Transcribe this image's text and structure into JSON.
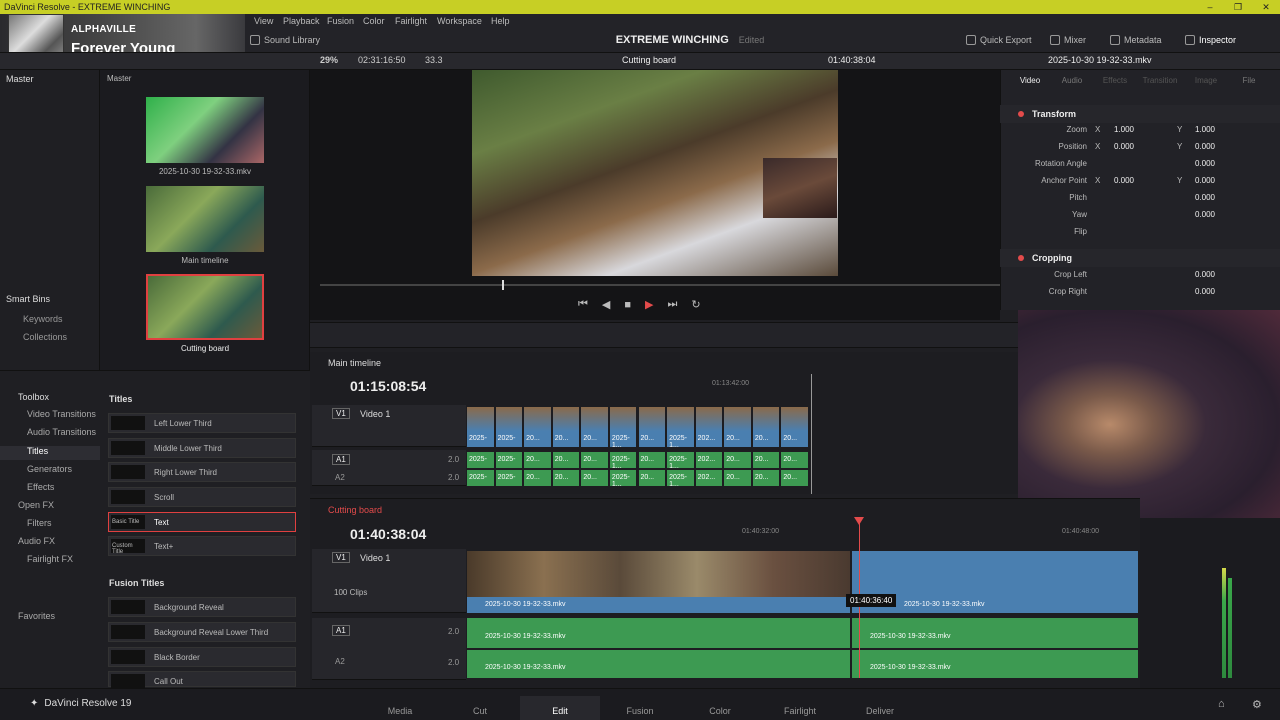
{
  "window": {
    "title": "DaVinci Resolve - EXTREME WINCHING",
    "controls": [
      "–",
      "❐",
      "✕"
    ]
  },
  "now_playing": {
    "artist": "ALPHAVILLE",
    "song": "Forever Young"
  },
  "menu": [
    "View",
    "Playback",
    "Fusion",
    "Color",
    "Fairlight",
    "Workspace",
    "Help"
  ],
  "project": {
    "name": "EXTREME WINCHING",
    "status": "Edited"
  },
  "top_buttons": {
    "sound_library": "Sound Library",
    "quick_export": "Quick Export",
    "mixer": "Mixer",
    "metadata": "Metadata",
    "inspector": "Inspector"
  },
  "viewer_bar": {
    "zoom": "29%",
    "source_tc": "02:31:16:50",
    "fps": "33.3",
    "viewer_name": "Cutting board",
    "timeline_tc": "01:40:38:04",
    "clip_name": "2025-10-30 19-32-33.mkv"
  },
  "left_panel": {
    "master_label": "Master",
    "bins_label": "Master",
    "smart_bins": "Smart Bins",
    "keywords": "Keywords",
    "collections": "Collections"
  },
  "media": [
    {
      "caption": "2025-10-30 19-32-33.mkv"
    },
    {
      "caption": "Main timeline"
    },
    {
      "caption": "Cutting board"
    }
  ],
  "inspector": {
    "tabs": [
      "Video",
      "Audio",
      "Effects",
      "Transition",
      "Image",
      "File"
    ],
    "transform_title": "Transform",
    "zoom_label": "Zoom",
    "zoom_x": "1.000",
    "zoom_y": "1.000",
    "position_label": "Position",
    "pos_x": "0.000",
    "pos_y": "0.000",
    "rotation_label": "Rotation Angle",
    "rotation": "0.000",
    "anchor_label": "Anchor Point",
    "anchor_x": "0.000",
    "anchor_y": "0.000",
    "pitch_label": "Pitch",
    "pitch": "0.000",
    "yaw_label": "Yaw",
    "yaw": "0.000",
    "flip_label": "Flip",
    "cropping_title": "Cropping",
    "crop_left_label": "Crop Left",
    "crop_left": "0.000",
    "crop_right_label": "Crop Right",
    "crop_right": "0.000",
    "x": "X",
    "y": "Y"
  },
  "effects": {
    "toolbox": "Toolbox",
    "items": [
      "Video Transitions",
      "Audio Transitions",
      "Titles",
      "Generators",
      "Effects"
    ],
    "open_fx": "Open FX",
    "filters": "Filters",
    "audio_fx": "Audio FX",
    "fairlight_fx": "Fairlight FX",
    "favorites": "Favorites",
    "titles_header": "Titles",
    "titles": [
      "Left Lower Third",
      "Middle Lower Third",
      "Right Lower Third",
      "Scroll",
      "Text",
      "Text+"
    ],
    "fusion_header": "Fusion Titles",
    "fusion_titles": [
      "Background Reveal",
      "Background Reveal Lower Third",
      "Black Border",
      "Call Out"
    ],
    "text_swatch": "Basic Title",
    "textplus_swatch": "Custom Title"
  },
  "timeline_main": {
    "tab": "Main timeline",
    "tc": "01:15:08:54",
    "ruler_tc": "01:13:42:00",
    "v1": "V1",
    "video1": "Video 1",
    "a1": "A1",
    "a2": "A2",
    "level": "2.0"
  },
  "timeline_cut": {
    "tab": "Cutting board",
    "tc": "01:40:38:04",
    "ruler1": "01:40:32:00",
    "ruler2": "01:40:48:00",
    "v1": "V1",
    "video1": "Video 1",
    "clips": "100 Clips",
    "a1": "A1",
    "a2": "A2",
    "level": "2.0",
    "clip": "2025-10-30 19-32-33.mkv",
    "hover_tc": "01:40:36:40"
  },
  "mini_clips": [
    "2025-",
    "2025-",
    "20...",
    "20...",
    "20...",
    "2025-1...",
    "20...",
    "2025-1...",
    "202...",
    "20...",
    "20...",
    "20..."
  ],
  "pages": [
    "Media",
    "Cut",
    "Edit",
    "Fusion",
    "Color",
    "Fairlight",
    "Deliver"
  ],
  "active_page": "Edit",
  "brand": "DaVinci Resolve 19"
}
